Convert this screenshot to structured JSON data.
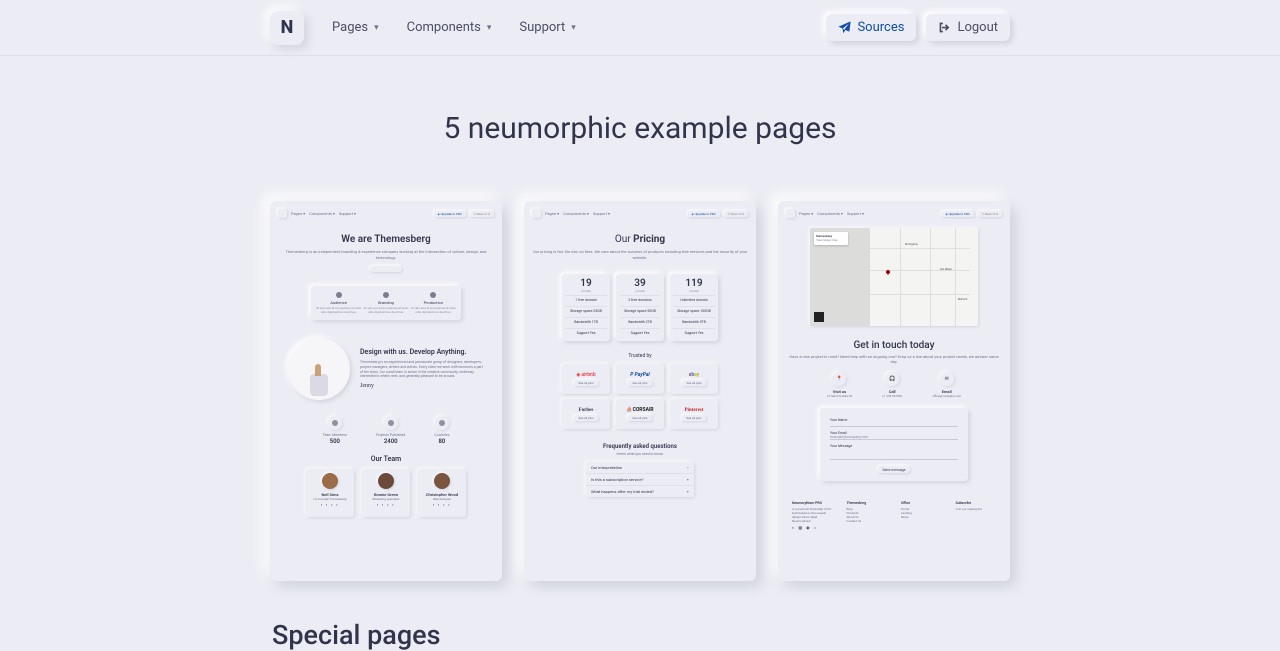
{
  "nav": {
    "logo_text": "N",
    "items": [
      "Pages",
      "Components",
      "Support"
    ],
    "sources_label": "Sources",
    "logout_label": "Logout"
  },
  "hero_title": "5 neumorphic example pages",
  "about": {
    "heading": "We are Themesberg",
    "sub": "Themesberg is an independent branding & experience company working at the intersection of culture, design, and technology.",
    "features": [
      "Audience",
      "Branding",
      "Production"
    ],
    "feature_desc": "At vero eos et accusamus et iusto odio dignissimos ducimus.",
    "design_heading": "Design with us. Develop Anything.",
    "design_para": "Themesberg is an experienced and passionate group of designers, developers, project managers, writers and artists. Every client we work with becomes a part of the team. Our small team is active in the creative community, endlessly interested in what's next, and generally pleasant to be around.",
    "stats": [
      {
        "label": "Team Members",
        "value": "500"
      },
      {
        "label": "Projects Published",
        "value": "2400"
      },
      {
        "label": "Countries",
        "value": "80"
      }
    ],
    "team_heading": "Our Team",
    "team": [
      {
        "name": "Neil Sims",
        "role": "Co-Founder Themesberg"
      },
      {
        "name": "Bonnie Green",
        "role": "Marketing specialist"
      },
      {
        "name": "Christopher Wood",
        "role": "Web designer"
      }
    ]
  },
  "pricing": {
    "heading": "Our Pricing",
    "sub": "Our pricing is fair. No risk, no fees. We care about the success of products including free services and the security of your website.",
    "plans": [
      {
        "price": "19",
        "features": [
          "1 free domain",
          "Storage space 25GB",
          "Bandwidth 1TB",
          "Support Yes"
        ]
      },
      {
        "price": "39",
        "features": [
          "2 free domains",
          "Storage space 50GB",
          "Bandwidth 2TB",
          "Support Yes"
        ]
      },
      {
        "price": "119",
        "features": [
          "Unlimited domain",
          "Storage space 100GB",
          "Bandwidth 5TB",
          "Support Yes"
        ]
      }
    ],
    "per_month": "/month",
    "trusted_label": "Trusted by",
    "brands": [
      "airbnb",
      "PayPal",
      "ebay",
      "Forbes",
      "CORSAIR",
      "Pinterest"
    ],
    "see_all": "See all jobs",
    "faq_heading": "Frequently asked questions",
    "faq_sub": "Here's what you need to know.",
    "faq_items": [
      "Our interpretation",
      "Is this a subscription service?",
      "What happens after my trial ended?"
    ]
  },
  "contact": {
    "search_label": "themesberg",
    "search_hint": "View larger map",
    "heading": "Get in touch today",
    "sub": "Have a new project in mind? Need help with an ongoing one? Drop us a line about your project needs, we answer same day.",
    "cols": [
      {
        "title": "Visit us",
        "detail": "27 Saint Andrew St"
      },
      {
        "title": "Call",
        "detail": "+1 234 567890"
      },
      {
        "title": "Email",
        "detail": "office@company.com"
      }
    ],
    "form": {
      "name_label": "Your Name",
      "email_label": "Your Email",
      "email_ph": "example@company.com",
      "msg_label": "Your Message",
      "send_label": "Send message"
    },
    "footer_cols": [
      "Themesberg",
      "Office",
      "Subscribe"
    ]
  },
  "special_heading": "Special pages"
}
